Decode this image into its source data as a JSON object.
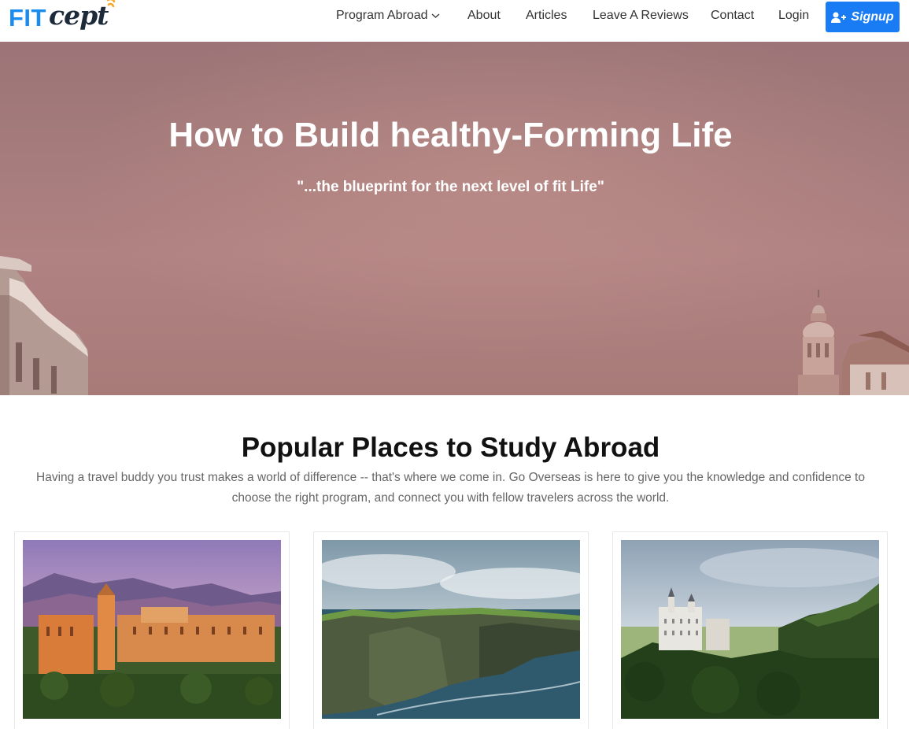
{
  "brand": {
    "logo_fit": "FIT",
    "logo_cept": "cept",
    "accent": "#1a8cf0"
  },
  "nav": {
    "items": [
      {
        "label": "Program Abroad",
        "has_dropdown": true
      },
      {
        "label": "About"
      },
      {
        "label": "Articles"
      },
      {
        "label": "Leave A Reviews"
      },
      {
        "label": "Contact"
      },
      {
        "label": "Login"
      }
    ],
    "signup_label": "Signup",
    "signup_icon": "user-plus-icon",
    "signup_color": "#1a7cf5"
  },
  "hero": {
    "title": "How to Build healthy-Forming Life",
    "subtitle": "\"...the blueprint for the next level of fit Life\""
  },
  "section": {
    "title": "Popular Places to Study Abroad",
    "description": "Having a travel buddy you trust makes a world of difference -- that's where we come in. Go Overseas is here to give you the knowledge and confidence to choose the right program, and connect you with fellow travelers across the world."
  },
  "cards": [
    {
      "image": "alhambra-palace-sunset"
    },
    {
      "image": "cliffs-of-moher-coast"
    },
    {
      "image": "neuschwanstein-castle-forest"
    }
  ]
}
